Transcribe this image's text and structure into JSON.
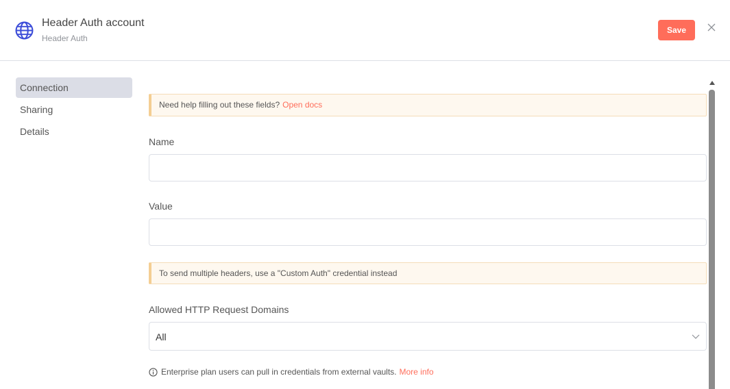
{
  "header": {
    "icon": "globe-icon",
    "title": "Header Auth account",
    "subtitle": "Header Auth",
    "save_label": "Save",
    "close_icon": "close-icon"
  },
  "sidebar": {
    "items": [
      {
        "label": "Connection",
        "active": true
      },
      {
        "label": "Sharing",
        "active": false
      },
      {
        "label": "Details",
        "active": false
      }
    ]
  },
  "main": {
    "help_notice": {
      "text": "Need help filling out these fields?",
      "link": "Open docs"
    },
    "name_field": {
      "label": "Name",
      "value": ""
    },
    "value_field": {
      "label": "Value",
      "value": ""
    },
    "headers_notice": {
      "text": "To send multiple headers, use a \"Custom Auth\" credential instead"
    },
    "domains_field": {
      "label": "Allowed HTTP Request Domains",
      "value": "All"
    },
    "info": {
      "text": "Enterprise plan users can pull in credentials from external vaults.",
      "link": "More info"
    }
  },
  "colors": {
    "accent": "#ff6d5a",
    "globe": "#3b4cd8",
    "active_nav_bg": "#dbdde6",
    "notice_bg": "#fef8ef",
    "notice_border": "#f4ce93"
  }
}
